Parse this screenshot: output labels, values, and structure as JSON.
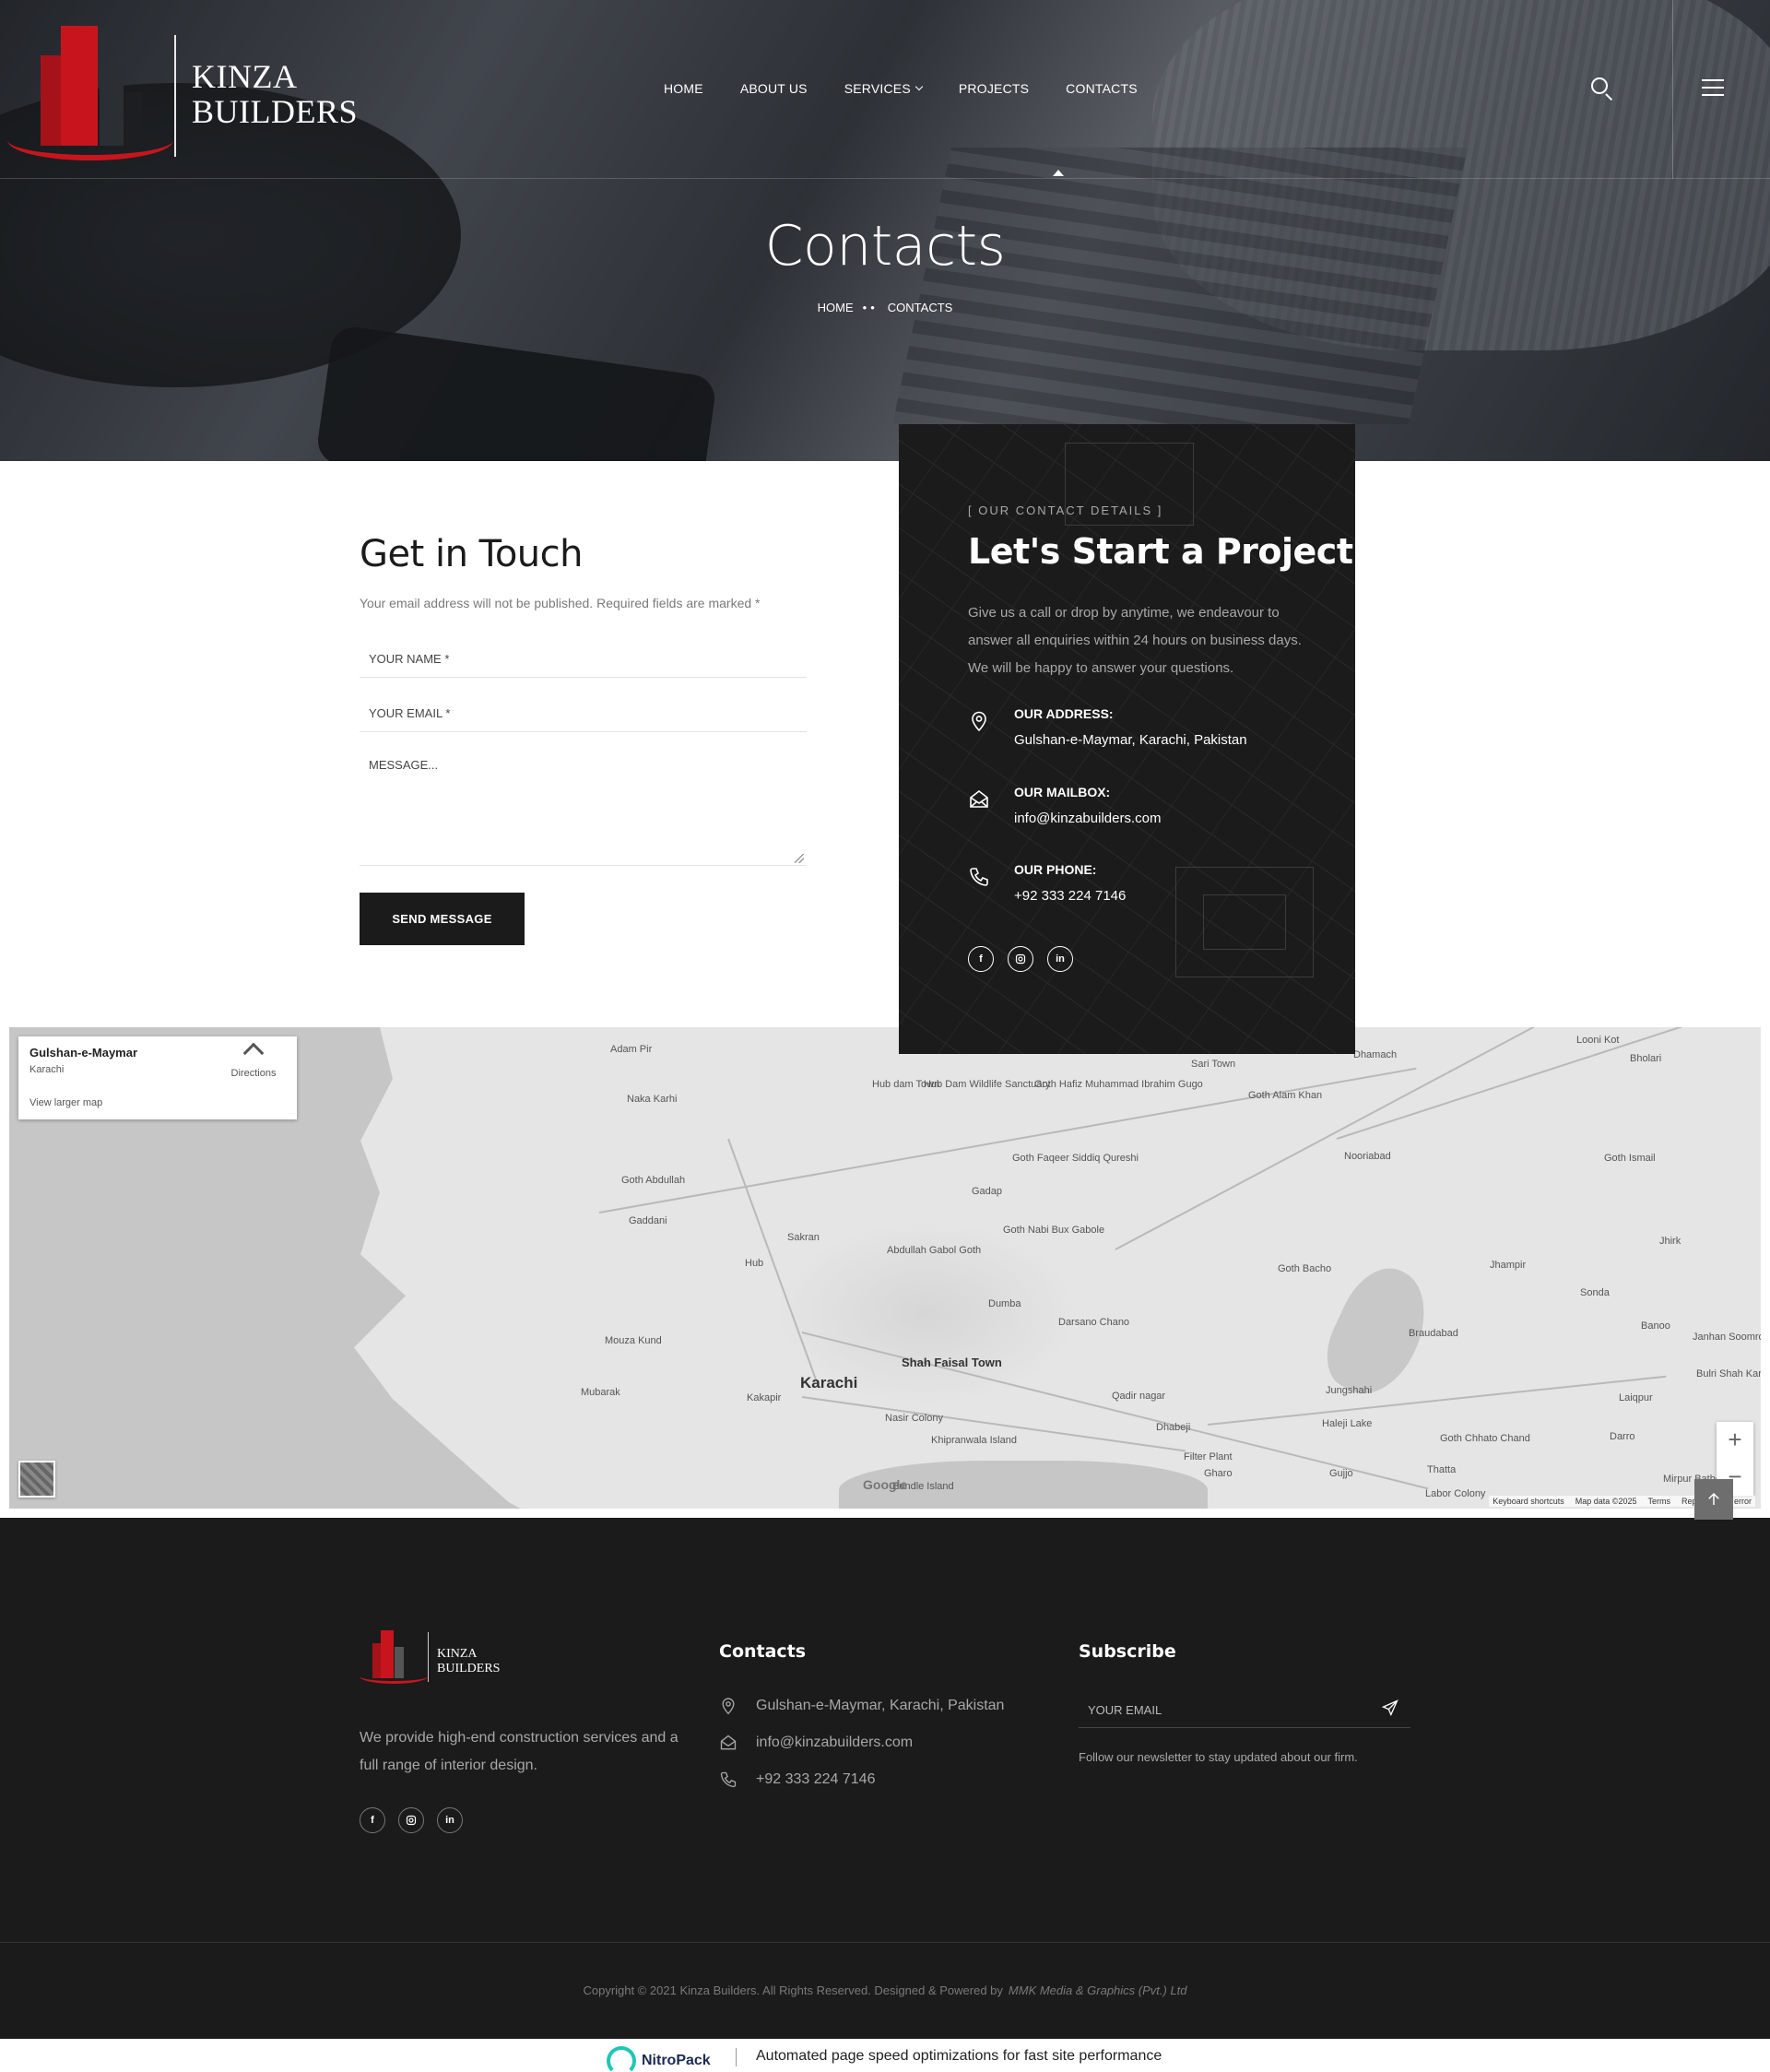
{
  "header": {
    "logo_text_line1": "KINZA",
    "logo_text_line2": "BUILDERS",
    "nav": [
      {
        "label": "HOME"
      },
      {
        "label": "ABOUT US"
      },
      {
        "label": "SERVICES"
      },
      {
        "label": "PROJECTS"
      },
      {
        "label": "CONTACTS"
      }
    ],
    "search_icon": "search-icon",
    "menu_icon": "hamburger-icon"
  },
  "hero": {
    "title": "Contacts",
    "breadcrumb": [
      "HOME",
      "CONTACTS"
    ]
  },
  "form": {
    "title": "Get in Touch",
    "note": "Your email address will not be published. Required fields are marked *",
    "name_placeholder": "YOUR NAME *",
    "email_placeholder": "YOUR EMAIL *",
    "message_placeholder": "MESSAGE...",
    "submit_label": "SEND MESSAGE"
  },
  "contact_card": {
    "eyebrow": "[ OUR CONTACT DETAILS ]",
    "title": "Let's Start a Project",
    "description": "Give us a call or drop by anytime, we endeavour to answer all enquiries within 24 hours on business days. We will be happy to answer your questions.",
    "items": [
      {
        "label": "OUR ADDRESS:",
        "value": "Gulshan-e-Maymar, Karachi, Pakistan",
        "icon": "location-pin-icon"
      },
      {
        "label": "OUR MAILBOX:",
        "value": "info@kinzabuilders.com",
        "icon": "envelope-icon"
      },
      {
        "label": "OUR PHONE:",
        "value": "+92 333 224 7146",
        "icon": "phone-icon"
      }
    ],
    "socials": [
      "f",
      "ig",
      "in"
    ]
  },
  "map": {
    "place_title": "Gulshan-e-Maymar",
    "place_subtitle": "Karachi",
    "directions_label": "Directions",
    "larger_map_label": "View larger map",
    "zoom_in": "+",
    "zoom_out": "−",
    "google_label": "Google",
    "attribution": [
      "Keyboard shortcuts",
      "Map data ©2025",
      "Terms",
      "Report a map error"
    ],
    "labels": [
      {
        "text": "Karachi",
        "cls": "big"
      },
      {
        "text": "Shah Faisal Town",
        "cls": "med"
      },
      {
        "text": "Adam Pir",
        "cls": ""
      },
      {
        "text": "Naka Karhi",
        "cls": ""
      },
      {
        "text": "Hub dam Town",
        "cls": ""
      },
      {
        "text": "Hub Dam Wildlife Sanctuary",
        "cls": ""
      },
      {
        "text": "Goth Hafiz Muhammad Ibrahim Gugo",
        "cls": ""
      },
      {
        "text": "Sari Town",
        "cls": ""
      },
      {
        "text": "Goth Alam Khan",
        "cls": ""
      },
      {
        "text": "Dhamach",
        "cls": ""
      },
      {
        "text": "Looni Kot",
        "cls": ""
      },
      {
        "text": "Bholari",
        "cls": ""
      },
      {
        "text": "Goth Abdullah",
        "cls": ""
      },
      {
        "text": "Goth Faqeer Siddiq Qureshi",
        "cls": ""
      },
      {
        "text": "Nooriabad",
        "cls": ""
      },
      {
        "text": "Goth Ismail",
        "cls": ""
      },
      {
        "text": "Gaddani",
        "cls": ""
      },
      {
        "text": "Gadap",
        "cls": ""
      },
      {
        "text": "Sakran",
        "cls": ""
      },
      {
        "text": "Hub",
        "cls": ""
      },
      {
        "text": "Abdullah Gabol Goth",
        "cls": ""
      },
      {
        "text": "Goth Nabi Bux Gabole",
        "cls": ""
      },
      {
        "text": "Goth Bacho",
        "cls": ""
      },
      {
        "text": "Jhampir",
        "cls": ""
      },
      {
        "text": "Jhirk",
        "cls": ""
      },
      {
        "text": "Sonda",
        "cls": ""
      },
      {
        "text": "Dumba",
        "cls": ""
      },
      {
        "text": "Darsano Chano",
        "cls": ""
      },
      {
        "text": "Braudabad",
        "cls": ""
      },
      {
        "text": "Banoo",
        "cls": ""
      },
      {
        "text": "Janhan Soomro",
        "cls": ""
      },
      {
        "text": "Mouza Kund",
        "cls": ""
      },
      {
        "text": "Mubarak",
        "cls": ""
      },
      {
        "text": "Kakapir",
        "cls": ""
      },
      {
        "text": "Nasir Colony",
        "cls": ""
      },
      {
        "text": "Qadir nagar",
        "cls": ""
      },
      {
        "text": "Jungshahi",
        "cls": ""
      },
      {
        "text": "Haleji Lake",
        "cls": ""
      },
      {
        "text": "Laiqpur",
        "cls": ""
      },
      {
        "text": "Khipranwala Island",
        "cls": ""
      },
      {
        "text": "Dhabeji",
        "cls": ""
      },
      {
        "text": "Filter Plant",
        "cls": ""
      },
      {
        "text": "Gharo",
        "cls": ""
      },
      {
        "text": "Goth Chhato Chand",
        "cls": ""
      },
      {
        "text": "Darro",
        "cls": ""
      },
      {
        "text": "Gujjo",
        "cls": ""
      },
      {
        "text": "Thatta",
        "cls": ""
      },
      {
        "text": "Labor Colony",
        "cls": ""
      },
      {
        "text": "Mirpur Bathoro",
        "cls": ""
      },
      {
        "text": "Bulri Shah Karim",
        "cls": ""
      },
      {
        "text": "Bundle Island",
        "cls": ""
      }
    ]
  },
  "footer": {
    "logo_text_line1": "KINZA",
    "logo_text_line2": "BUILDERS",
    "description": "We provide high-end construction services and a full range of interior design.",
    "socials": [
      "f",
      "ig",
      "in"
    ],
    "contacts_title": "Contacts",
    "contacts": [
      {
        "text": "Gulshan-e-Maymar, Karachi, Pakistan",
        "icon": "location-pin-icon"
      },
      {
        "text": "info@kinzabuilders.com",
        "icon": "envelope-icon"
      },
      {
        "text": "+92 333 224 7146",
        "icon": "phone-icon"
      }
    ],
    "subscribe_title": "Subscribe",
    "subscribe_placeholder": "YOUR EMAIL",
    "subscribe_note": "Follow our newsletter to stay updated about our firm.",
    "copyright": "Copyright © 2021 Kinza Builders. All Rights Reserved. Designed & Powered by",
    "copyright_company": "MMK Media & Graphics (Pvt.) Ltd"
  },
  "nitropack": {
    "brand": "NitroPack",
    "tagline": "Automated page speed optimizations for fast site performance"
  },
  "colors": {
    "accent_red": "#c8151d",
    "dark": "#1b1b1b",
    "muted_text": "#a8a8a8"
  }
}
